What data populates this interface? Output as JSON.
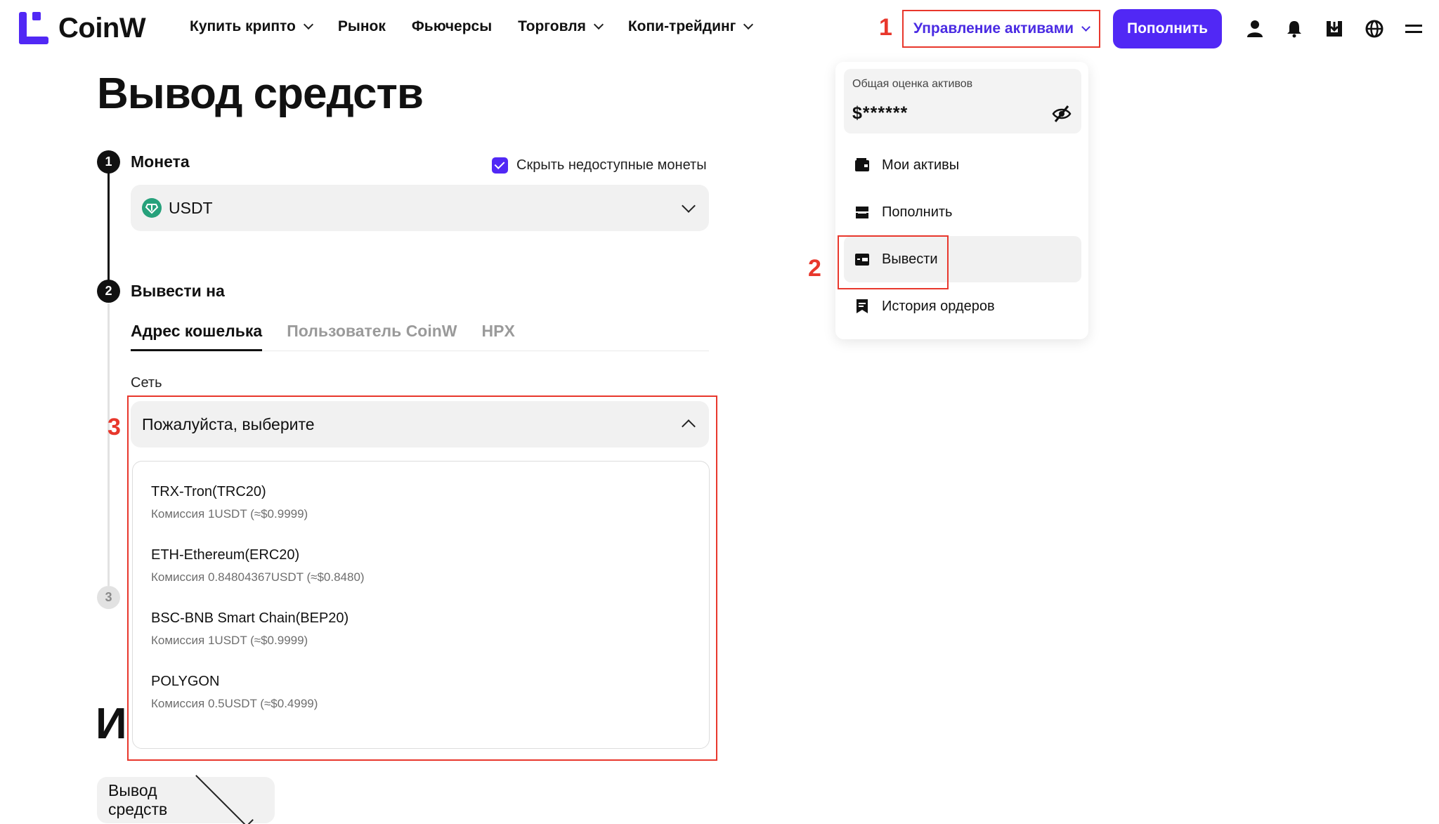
{
  "header": {
    "logo_text": "CoinW",
    "nav": [
      {
        "label": "Купить крипто",
        "dropdown": true
      },
      {
        "label": "Рынок",
        "dropdown": false
      },
      {
        "label": "Фьючерсы",
        "dropdown": false
      },
      {
        "label": "Торговля",
        "dropdown": true
      },
      {
        "label": "Копи-трейдинг",
        "dropdown": true
      }
    ],
    "asset_management_label": "Управление активами",
    "deposit_label": "Пополнить",
    "icons": [
      "user-icon",
      "bell-icon",
      "download-icon",
      "globe-icon",
      "menu-icon"
    ]
  },
  "annotations": {
    "one": "1",
    "two": "2",
    "three": "3"
  },
  "page": {
    "title": "Вывод средств",
    "step1": {
      "number": "1",
      "label": "Монета"
    },
    "hide_unavailable_label": "Скрыть недоступные монеты",
    "coin_selected": "USDT",
    "step2": {
      "number": "2",
      "label": "Вывести на"
    },
    "tabs": [
      {
        "label": "Адрес кошелька",
        "active": true
      },
      {
        "label": "Пользователь CoinW",
        "active": false
      },
      {
        "label": "HPX",
        "active": false
      }
    ],
    "network_label": "Сеть",
    "network_placeholder": "Пожалуйста, выберите",
    "networks": [
      {
        "name": "TRX-Tron(TRC20)",
        "fee": "Комиссия 1USDT (≈$0.9999)"
      },
      {
        "name": "ETH-Ethereum(ERC20)",
        "fee": "Комиссия 0.84804367USDT (≈$0.8480)"
      },
      {
        "name": "BSC-BNB Smart Chain(BEP20)",
        "fee": "Комиссия 1USDT (≈$0.9999)"
      },
      {
        "name": "POLYGON",
        "fee": "Комиссия 0.5USDT (≈$0.4999)"
      }
    ],
    "step3": {
      "number": "3"
    },
    "bg_heading_letter": "И",
    "history_select": "Вывод средств"
  },
  "asset_panel": {
    "estimate_label": "Общая оценка активов",
    "estimate_value": "$******",
    "items": [
      {
        "label": "Мои активы",
        "icon": "wallet-icon"
      },
      {
        "label": "Пополнить",
        "icon": "deposit-icon"
      },
      {
        "label": "Вывести",
        "icon": "withdraw-icon",
        "highlighted": true
      },
      {
        "label": "История ордеров",
        "icon": "order-history-icon"
      }
    ]
  },
  "colors": {
    "accent": "#5128F5",
    "accent_text": "#4A2BE3",
    "annotation": "#E8372C",
    "usdt": "#26A17B"
  }
}
